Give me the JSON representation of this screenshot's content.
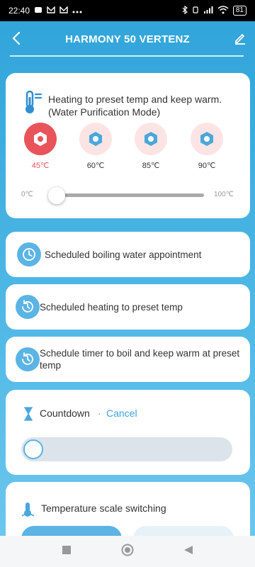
{
  "status_bar": {
    "time": "22:40",
    "battery": "81"
  },
  "header": {
    "title": "HARMONY 50 VERTENZ"
  },
  "heating": {
    "mode_text": "Heating to preset temp and keep warm.(Water Purification Mode)",
    "presets": [
      {
        "label": "45℃",
        "active": true
      },
      {
        "label": "60℃",
        "active": false
      },
      {
        "label": "85℃",
        "active": false
      },
      {
        "label": "90℃",
        "active": false
      }
    ],
    "slider": {
      "min_label": "0℃",
      "max_label": "100℃",
      "value_percent": 0
    }
  },
  "schedules": [
    {
      "label": "Scheduled boiling water appointment"
    },
    {
      "label": "Scheduled heating to preset temp"
    },
    {
      "label": "Schedule timer to boil and keep warm at preset temp"
    }
  ],
  "countdown": {
    "label": "Countdown",
    "separator": "·",
    "cancel": "Cancel"
  },
  "temperature_scale": {
    "label": "Temperature scale switching"
  },
  "colors": {
    "accent": "#5bb4e4",
    "active": "#e8545a",
    "link": "#3aa3d8"
  }
}
